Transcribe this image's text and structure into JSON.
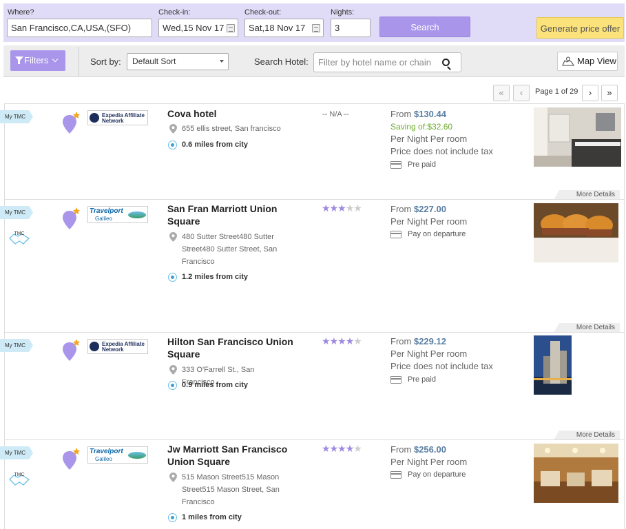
{
  "search": {
    "where_label": "Where?",
    "where_value": "San Francisco,CA,USA,(SFO)",
    "checkin_label": "Check-in:",
    "checkin_value": "Wed,15 Nov 17",
    "checkout_label": "Check-out:",
    "checkout_value": "Sat,18 Nov 17",
    "nights_label": "Nights:",
    "nights_value": "3",
    "search_button": "Search",
    "offer_button": "Generate price offer"
  },
  "toolbar": {
    "filters_label": "Filters",
    "sort_label": "Sort by:",
    "sort_value": "Default Sort",
    "search_hotel_label": "Search Hotel:",
    "search_hotel_placeholder": "Filter by hotel name or chain",
    "map_view_label": "Map View"
  },
  "pager": {
    "first": "«",
    "prev": "‹",
    "page_text": "Page 1 of 29",
    "next": "›",
    "last": "»"
  },
  "common": {
    "my_tmc": "My TMC",
    "tmc": "TMC",
    "more_details": "More Details",
    "per_night": "Per Night Per room",
    "from": "From",
    "no_tax": "Price does not include tax"
  },
  "hotels": [
    {
      "name": "Cova hotel",
      "brand": "Expedia Affiliate Network",
      "address": "655 ellis street, San francisco",
      "distance": "0.6 miles from city",
      "rating_text": "-- N/A --",
      "price": "$130.44",
      "saving": "Saving of:$32.60",
      "payment": "Pre paid"
    },
    {
      "name": "San Fran Marriott Union Square",
      "brand": "Travelport Galileo",
      "address": "480 Sutter Street480 Sutter Street480 Sutter Street, San Francisco",
      "distance": "1.2 miles from city",
      "stars": 3,
      "price": "$227.00",
      "payment": "Pay on departure"
    },
    {
      "name": "Hilton San Francisco Union Square",
      "brand": "Expedia Affiliate Network",
      "address": "333 O'Farrell St., San Francisco",
      "distance": "0.9 miles from city",
      "stars": 4,
      "price": "$229.12",
      "payment": "Pre paid"
    },
    {
      "name": "Jw Marriott San Francisco Union Square",
      "brand": "Travelport Galileo",
      "address": "515 Mason Street515 Mason Street515 Mason Street, San Francisco",
      "distance": "1 miles from city",
      "stars": 4,
      "price": "$256.00",
      "payment": "Pay on departure"
    }
  ],
  "brand_text": {
    "expedia_line1": "Expedia Affiliate",
    "expedia_line2": "Network",
    "travelport_line1": "Travelport",
    "travelport_line2": "Galileo"
  },
  "colors": {
    "accent": "#a996ea",
    "search_bar_bg": "#e0dbf6",
    "offer_button": "#fbe27a",
    "saving_text": "#6dac2f",
    "price_text": "#5a7ea3"
  }
}
